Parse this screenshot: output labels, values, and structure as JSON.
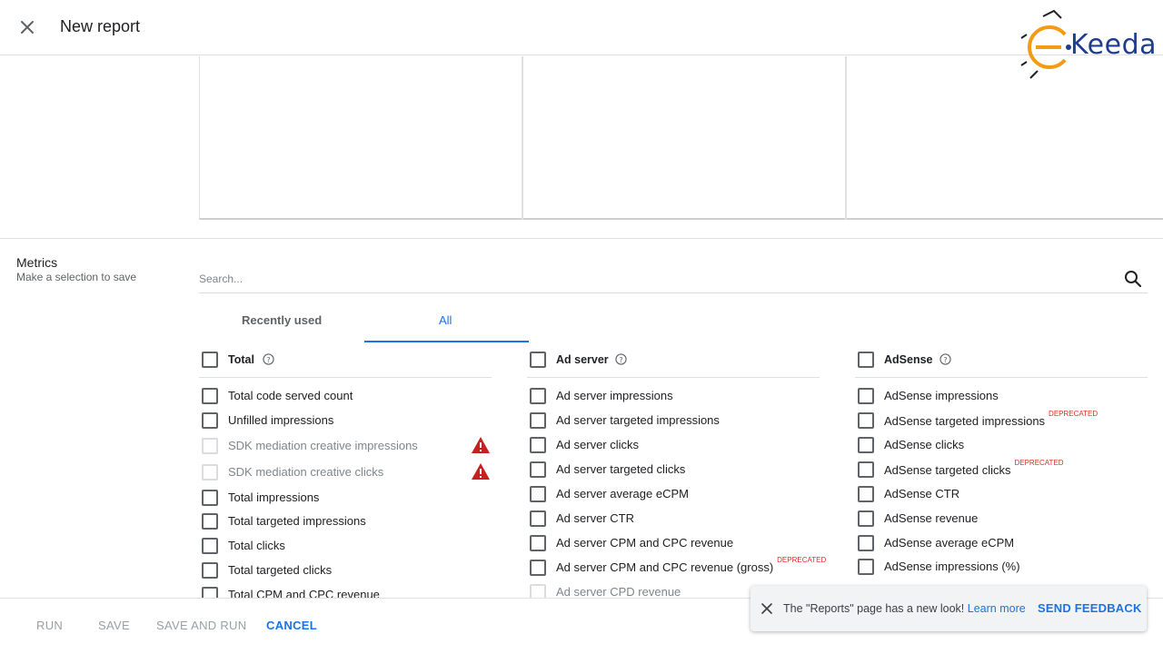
{
  "header": {
    "title": "New report"
  },
  "logo": {
    "text": "Keeda",
    "brand_color": "#1f3d8f",
    "accent_color": "#f39c12"
  },
  "metrics": {
    "title": "Metrics",
    "subtitle": "Make a selection to save",
    "search_placeholder": "Search...",
    "tabs": [
      {
        "label": "Recently used",
        "selected": false
      },
      {
        "label": "All",
        "selected": true
      }
    ],
    "groups": [
      {
        "title": "Total",
        "items": [
          {
            "label": "Total code served count"
          },
          {
            "label": "Unfilled impressions"
          },
          {
            "label": "SDK mediation creative impressions",
            "disabled": true,
            "warning": true
          },
          {
            "label": "SDK mediation creative clicks",
            "disabled": true,
            "warning": true
          },
          {
            "label": "Total impressions"
          },
          {
            "label": "Total targeted impressions"
          },
          {
            "label": "Total clicks"
          },
          {
            "label": "Total targeted clicks"
          },
          {
            "label": "Total CPM and CPC revenue"
          }
        ]
      },
      {
        "title": "Ad server",
        "items": [
          {
            "label": "Ad server impressions"
          },
          {
            "label": "Ad server targeted impressions"
          },
          {
            "label": "Ad server clicks"
          },
          {
            "label": "Ad server targeted clicks"
          },
          {
            "label": "Ad server average eCPM"
          },
          {
            "label": "Ad server CTR"
          },
          {
            "label": "Ad server CPM and CPC revenue"
          },
          {
            "label": "Ad server CPM and CPC revenue (gross)",
            "badge": "DEPRECATED"
          },
          {
            "label": "Ad server CPD revenue",
            "disabled": true
          }
        ]
      },
      {
        "title": "AdSense",
        "items": [
          {
            "label": "AdSense impressions"
          },
          {
            "label": "AdSense targeted impressions",
            "badge": "DEPRECATED"
          },
          {
            "label": "AdSense clicks"
          },
          {
            "label": "AdSense targeted clicks",
            "badge": "DEPRECATED"
          },
          {
            "label": "AdSense CTR"
          },
          {
            "label": "AdSense revenue"
          },
          {
            "label": "AdSense average eCPM"
          },
          {
            "label": "AdSense impressions (%)"
          }
        ]
      }
    ]
  },
  "footer": {
    "run": "RUN",
    "save": "SAVE",
    "save_and_run": "SAVE AND RUN",
    "cancel": "CANCEL"
  },
  "snackbar": {
    "message": "The \"Reports\" page has a new look!",
    "link": "Learn more",
    "action": "SEND FEEDBACK"
  },
  "colors": {
    "accent": "#1a73e8",
    "warning": "#c5221f",
    "deprecated": "#d93025"
  }
}
